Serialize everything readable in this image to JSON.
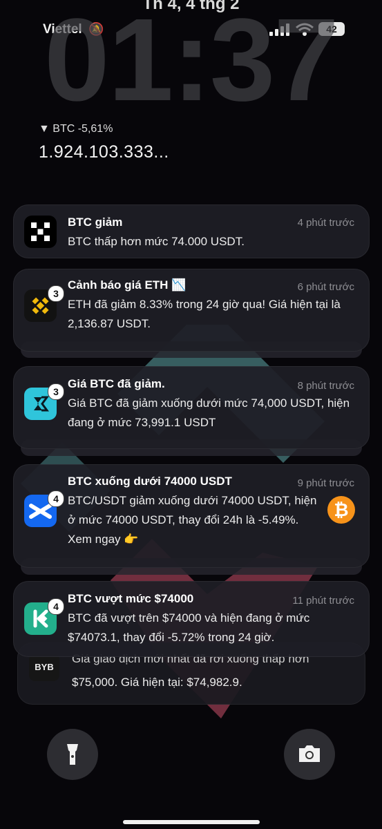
{
  "status_bar": {
    "carrier": "Viettel",
    "battery": "42"
  },
  "lock": {
    "date": "Th 4, 4 thg 2",
    "time": "01:37"
  },
  "widget": {
    "change": "▼ BTC -5,61%",
    "price": "1.924.103.333..."
  },
  "notifications": [
    {
      "title": "BTC giảm",
      "time": "4 phút trước",
      "body": "BTC thấp hơn mức 74.000 USDT.",
      "app_icon": "okx-icon"
    },
    {
      "title": "Cảnh báo giá ETH 📉",
      "time": "6 phút trước",
      "body": "ETH đã giảm 8.33% trong 24 giờ qua! Giá hiện tại là 2,136.87 USDT.",
      "badge": "3",
      "app_icon": "binance-icon"
    },
    {
      "title": "Giá BTC đã giảm.",
      "time": "8 phút trước",
      "body": "Giá BTC đã giảm xuống dưới mức 74,000 USDT, hiện đang ở mức 73,991.1 USDT",
      "badge": "3",
      "app_icon": "bitget-icon"
    },
    {
      "title": "BTC xuống dưới 74000 USDT",
      "time": "9 phút trước",
      "body": "BTC/USDT giảm xuống dưới 74000 USDT, hiện ở mức 74000 USDT, thay đổi 24h là -5.49%. Xem ngay 👉",
      "badge": "4",
      "app_icon": "mexc-icon",
      "thumb": "bitcoin-icon"
    },
    {
      "title": "BTC vượt mức $74000",
      "time": "11 phút trước",
      "body": "BTC đã vượt trên $74000 và hiện đang ở mức $74073.1, thay đổi -5.72% trong 24 giờ.",
      "badge": "4",
      "app_icon": "kucoin-icon"
    }
  ],
  "partial_notification": {
    "app_label": "BYB",
    "body_line1": "Giá giao dịch mới nhất đã rơi xuống thấp hơn",
    "body_line2": "$75,000. Giá hiện tại: $74,982.9."
  },
  "colors": {
    "binance": "#f0b90b",
    "bitcoin": "#f7931a",
    "bitget": "#1da2b4",
    "mexc": "#1972f5",
    "kucoin": "#24ae8f"
  }
}
